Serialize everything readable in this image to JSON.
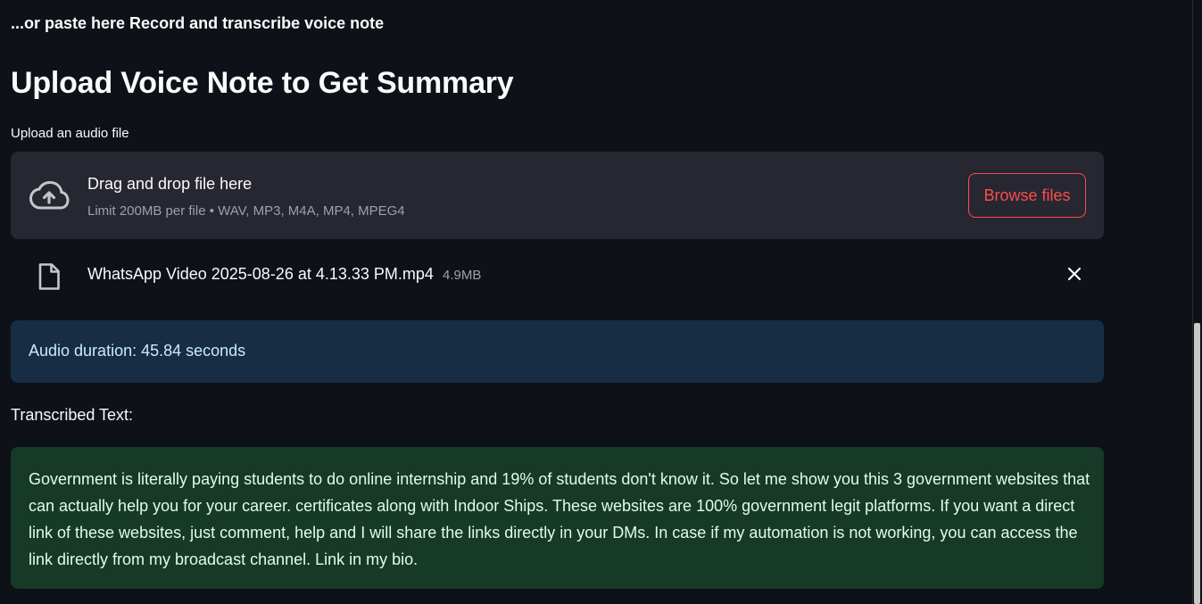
{
  "intro_text": "...or paste here Record and transcribe voice note",
  "title": "Upload Voice Note to Get Summary",
  "uploader": {
    "label": "Upload an audio file",
    "drop_title": "Drag and drop file here",
    "limit_text": "Limit 200MB per file • WAV, MP3, M4A, MP4, MPEG4",
    "browse_label": "Browse files",
    "icon": "cloud-upload-icon"
  },
  "file": {
    "name": "WhatsApp Video 2025-08-26 at 4.13.33 PM.mp4",
    "size": "4.9MB",
    "icon": "file-icon",
    "remove_icon": "close-icon"
  },
  "info": {
    "text": "Audio duration: 45.84 seconds"
  },
  "transcription": {
    "label": "Transcribed Text:",
    "text": "Government is literally paying students to do online internship and 19% of students don't know it. So let me show you this 3 government websites that can actually help you for your career. certificates along with Indoor Ships. These websites are 100% government legit platforms. If you want a direct link of these websites, just comment, help and I will share the links directly in your DMs. In case if my automation is not working, you can access the link directly from my broadcast channel. Link in my bio."
  },
  "colors": {
    "background": "#0e1117",
    "accent": "#ff4b4b",
    "info_bg": "#172d43",
    "success_bg": "#173928"
  }
}
